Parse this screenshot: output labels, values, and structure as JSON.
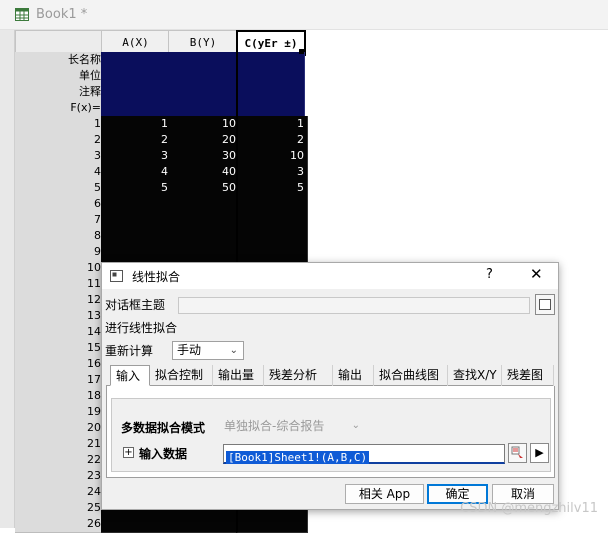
{
  "book": {
    "title": "Book1 *",
    "columns": [
      {
        "label": "A(X)"
      },
      {
        "label": "B(Y)"
      },
      {
        "label": "C(yEr ±)"
      }
    ],
    "meta_rows": [
      "长名称",
      "单位",
      "注释",
      "F(x)="
    ],
    "rows": [
      {
        "num": "1",
        "a": "1",
        "b": "10",
        "c": "1"
      },
      {
        "num": "2",
        "a": "2",
        "b": "20",
        "c": "2"
      },
      {
        "num": "3",
        "a": "3",
        "b": "30",
        "c": "10"
      },
      {
        "num": "4",
        "a": "4",
        "b": "40",
        "c": "3"
      },
      {
        "num": "5",
        "a": "5",
        "b": "50",
        "c": "5"
      },
      {
        "num": "6",
        "a": "",
        "b": "",
        "c": ""
      },
      {
        "num": "7",
        "a": "",
        "b": "",
        "c": ""
      },
      {
        "num": "8",
        "a": "",
        "b": "",
        "c": ""
      },
      {
        "num": "9",
        "a": "",
        "b": "",
        "c": ""
      },
      {
        "num": "10",
        "a": "",
        "b": "",
        "c": ""
      },
      {
        "num": "11",
        "a": "",
        "b": "",
        "c": ""
      },
      {
        "num": "12",
        "a": "",
        "b": "",
        "c": ""
      },
      {
        "num": "13",
        "a": "",
        "b": "",
        "c": ""
      },
      {
        "num": "14",
        "a": "",
        "b": "",
        "c": ""
      },
      {
        "num": "15",
        "a": "",
        "b": "",
        "c": ""
      },
      {
        "num": "16",
        "a": "",
        "b": "",
        "c": ""
      },
      {
        "num": "17",
        "a": "",
        "b": "",
        "c": ""
      },
      {
        "num": "18",
        "a": "",
        "b": "",
        "c": ""
      },
      {
        "num": "19",
        "a": "",
        "b": "",
        "c": ""
      },
      {
        "num": "20",
        "a": "",
        "b": "",
        "c": ""
      },
      {
        "num": "21",
        "a": "",
        "b": "",
        "c": ""
      },
      {
        "num": "22",
        "a": "",
        "b": "",
        "c": ""
      },
      {
        "num": "23",
        "a": "",
        "b": "",
        "c": ""
      },
      {
        "num": "24",
        "a": "",
        "b": "",
        "c": ""
      },
      {
        "num": "25",
        "a": "",
        "b": "",
        "c": ""
      },
      {
        "num": "26",
        "a": "",
        "b": "",
        "c": ""
      }
    ]
  },
  "dialog": {
    "title": "线性拟合",
    "help_label": "?",
    "close_label": "✕",
    "theme_label": "对话框主题",
    "heading": "进行线性拟合",
    "recalc_label": "重新计算",
    "recalc_value": "手动",
    "tabs": [
      "输入",
      "拟合控制",
      "输出量",
      "残差分析",
      "输出",
      "拟合曲线图",
      "查找X/Y",
      "残差图"
    ],
    "mode_label": "多数据拟合模式",
    "mode_value": "单独拟合-综合报告",
    "input_label": "输入数据",
    "input_value": "[Book1]Sheet1!(A,B,C)",
    "buttons": {
      "app": "相关 App",
      "ok": "确定",
      "cancel": "取消"
    }
  },
  "watermark": "CSDN @mengzhilv11",
  "colors": {
    "meta": "#0a0e5c",
    "data": "#050505",
    "selection": "#0f5bd6",
    "ok_border": "#0078d7"
  }
}
